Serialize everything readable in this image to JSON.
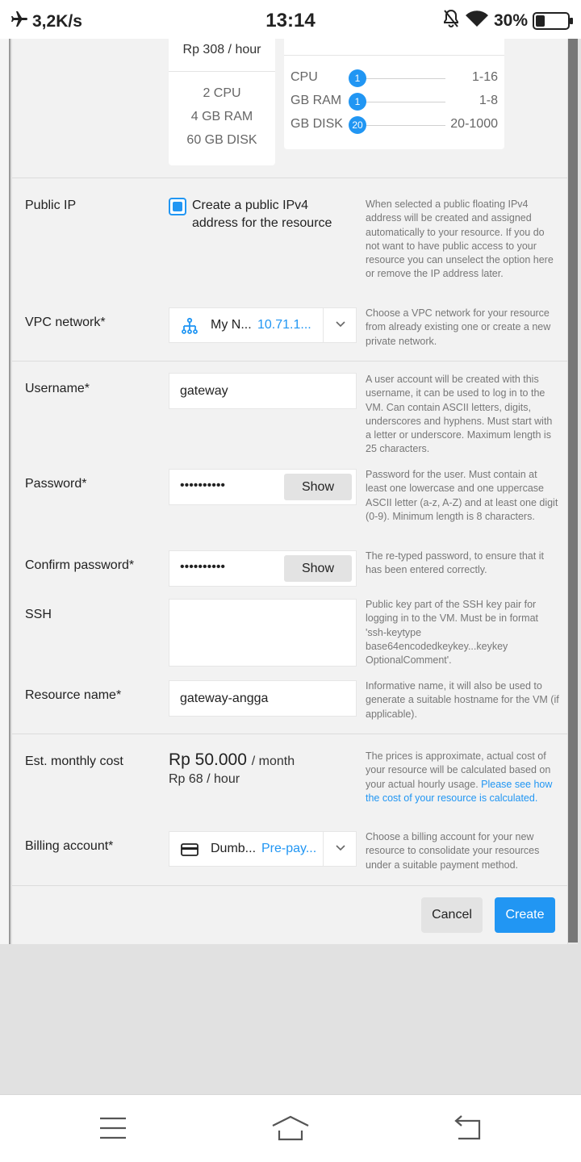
{
  "status_bar": {
    "speed": "3,2K/s",
    "time": "13:14",
    "battery": "30%",
    "battery_level": 0.3,
    "icons": [
      "airplane-icon",
      "bell-muted-icon",
      "wifi-icon",
      "battery-icon"
    ]
  },
  "size_selection": {
    "selected_card": {
      "price": "Rp 308 / hour",
      "specs": [
        "2 CPU",
        "4 GB RAM",
        "60 GB DISK"
      ]
    },
    "custom_card": {
      "sliders": [
        {
          "label": "CPU",
          "value": "1",
          "range": "1-16"
        },
        {
          "label": "GB RAM",
          "value": "1",
          "range": "1-8"
        },
        {
          "label": "GB DISK",
          "value": "20",
          "range": "20-1000"
        }
      ]
    }
  },
  "public_ip": {
    "label": "Public IP",
    "checkbox_label": "Create a public IPv4 address for the resource",
    "checked": true,
    "help": "When selected a public floating IPv4 address will be created and assigned automatically to your resource. If you do not want to have public access to your resource you can unselect the option here or remove the IP address later."
  },
  "vpc": {
    "label": "VPC network*",
    "name": "My N...",
    "address": "10.71.1...",
    "icon": "network-icon",
    "help": "Choose a VPC network for your resource from already existing one or create a new private network."
  },
  "username": {
    "label": "Username*",
    "value": "gateway",
    "help": "A user account will be created with this username, it can be used to log in to the VM. Can contain ASCII letters, digits, underscores and hyphens. Must start with a letter or underscore. Maximum length is 25 characters."
  },
  "password": {
    "label": "Password*",
    "masked": "••••••••••",
    "show_label": "Show",
    "help": "Password for the user. Must contain at least one lowercase and one uppercase ASCII letter (a-z, A-Z) and at least one digit (0-9). Minimum length is 8 characters."
  },
  "confirm_password": {
    "label": "Confirm password*",
    "masked": "••••••••••",
    "show_label": "Show",
    "help": "The re-typed password, to ensure that it has been entered correctly."
  },
  "ssh": {
    "label": "SSH",
    "value": "",
    "help": "Public key part of the SSH key pair for logging in to the VM. Must be in format 'ssh-keytype base64encodedkeykey...keykey OptionalComment'."
  },
  "resource_name": {
    "label": "Resource name*",
    "value": "gateway-angga",
    "help": "Informative name, it will also be used to generate a suitable hostname for the VM (if applicable)."
  },
  "cost": {
    "label": "Est. monthly cost",
    "monthly": "Rp 50.000",
    "monthly_unit": "/ month",
    "hourly": "Rp 68 / hour",
    "help": "The prices is approximate, actual cost of your resource will be calculated based on your actual hourly usage.",
    "help_link": "Please see how the cost of your resource is calculated."
  },
  "billing": {
    "label": "Billing account*",
    "name": "Dumb...",
    "type": "Pre-pay...",
    "icon": "credit-card-icon",
    "help": "Choose a billing account for your new resource to consolidate your resources under a suitable payment method."
  },
  "actions": {
    "cancel": "Cancel",
    "create": "Create"
  },
  "nav_bar": {
    "icons": [
      "menu-icon",
      "home-icon",
      "back-icon"
    ]
  }
}
